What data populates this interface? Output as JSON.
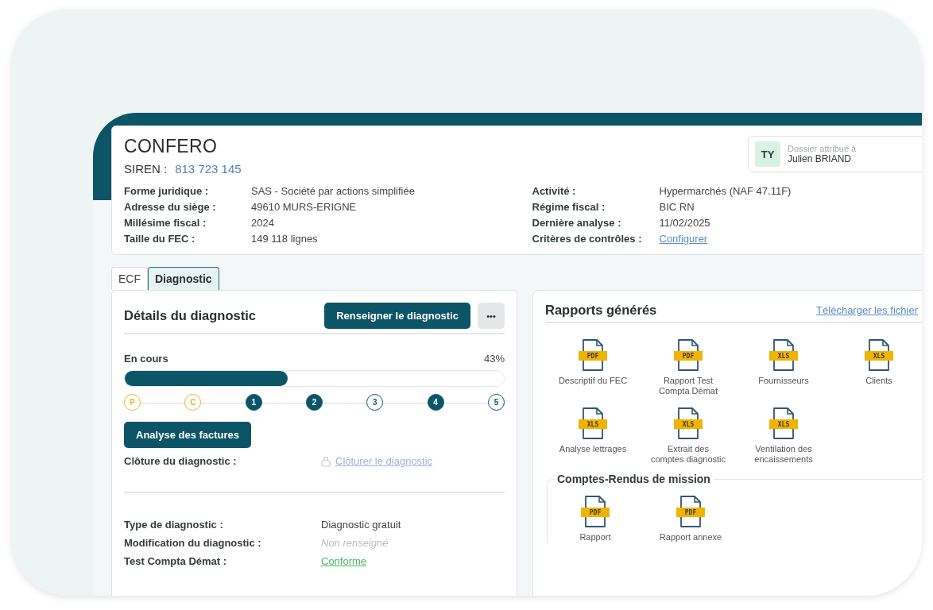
{
  "company": {
    "name": "CONFERO",
    "siren_label": "SIREN :",
    "siren": "813 723 145"
  },
  "assignee": {
    "initials": "TY",
    "caption": "Dossier attribué à",
    "name": "Julien BRIAND"
  },
  "info_left": [
    {
      "label": "Forme juridique :",
      "value": "SAS - Société par actions simplifiée",
      "kind": "text"
    },
    {
      "label": "Adresse du siège :",
      "value": "49610 MURS-ERIGNE",
      "kind": "text"
    },
    {
      "label": "Millésime fiscal :",
      "value": "2024",
      "kind": "text"
    },
    {
      "label": "Taille du FEC :",
      "value": "149 118 lignes",
      "kind": "text"
    }
  ],
  "info_right": [
    {
      "label": "Activité :",
      "value": "Hypermarchés (NAF 47.11F)",
      "kind": "text"
    },
    {
      "label": "Régime fiscal :",
      "value": "BIC RN",
      "kind": "text"
    },
    {
      "label": "Dernière analyse :",
      "value": "11/02/2025",
      "kind": "text"
    },
    {
      "label": "Critères de contrôles :",
      "value": "Configurer",
      "kind": "link"
    }
  ],
  "tabs": [
    {
      "label": "ECF",
      "selected": false
    },
    {
      "label": "Diagnostic",
      "selected": true
    }
  ],
  "diagnostic": {
    "title": "Détails du diagnostic",
    "primary_button": "Renseigner le diagnostic",
    "more_button": "•••",
    "status": "En cours",
    "percent": "43%",
    "level": 0.43,
    "steps": [
      {
        "label": "P",
        "kind": "letter",
        "completed": false
      },
      {
        "label": "C",
        "kind": "letter",
        "completed": false
      },
      {
        "label": "1",
        "kind": "number",
        "completed": true
      },
      {
        "label": "2",
        "kind": "number",
        "completed": true
      },
      {
        "label": "3",
        "kind": "number",
        "completed": false
      },
      {
        "label": "4",
        "kind": "number",
        "completed": true
      },
      {
        "label": "5",
        "kind": "number",
        "completed": false
      }
    ],
    "action_button": "Analyse des factures",
    "closure": {
      "label": "Clôture du diagnostic :",
      "link": "Clôturer le diagnostic",
      "disabled": true
    },
    "details": [
      {
        "label": "Type de diagnostic :",
        "value": "Diagnostic gratuit",
        "kind": "text"
      },
      {
        "label": "Modification du diagnostic :",
        "value": "Non renseigné",
        "kind": "empty"
      },
      {
        "label": "Test Compta Démat :",
        "value": "Conforme",
        "kind": "success"
      }
    ]
  },
  "reports": {
    "title": "Rapports générés",
    "download_link": "Télécharger les fichier",
    "files": [
      {
        "badge": "PDF",
        "name": "Descriptif du FEC"
      },
      {
        "badge": "PDF",
        "name": "Rapport Test Compta Démat"
      },
      {
        "badge": "XLS",
        "name": "Fournisseurs"
      },
      {
        "badge": "XLS",
        "name": "Clients"
      },
      {
        "badge": "XLS",
        "name": "Analyse lettrages"
      },
      {
        "badge": "XLS",
        "name": "Extrait des comptes diagnostic"
      },
      {
        "badge": "XLS",
        "name": "Ventilation des encaissements"
      }
    ],
    "missions": {
      "title": "Comptes-Rendus de mission",
      "files": [
        {
          "badge": "PDF",
          "name": "Rapport"
        },
        {
          "badge": "PDF",
          "name": "Rapport annexe"
        }
      ]
    }
  }
}
